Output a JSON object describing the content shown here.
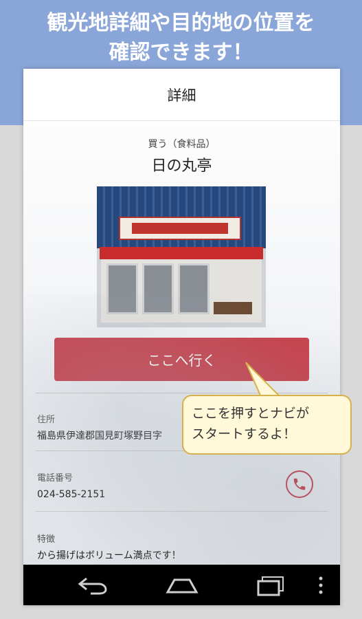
{
  "banner": {
    "line1": "観光地詳細や目的地の位置を",
    "line2": "確認できます！"
  },
  "appbar": {
    "title": "詳細"
  },
  "place": {
    "category": "買う（食料品）",
    "name": "日の丸亭"
  },
  "actions": {
    "go_label": "ここへ行く"
  },
  "fields": {
    "address_label": "住所",
    "address_value": "福島県伊達郡国見町塚野目字",
    "phone_label": "電話番号",
    "phone_value": "024-585-2151",
    "feature_label": "特徴",
    "feature_value": "から揚げはボリューム満点です！"
  },
  "tooltip": {
    "line1": "ここを押すとナビが",
    "line2": "スタートするよ！"
  },
  "icons": {
    "phone": "phone-icon",
    "back": "back-icon",
    "home": "home-icon",
    "recent": "recent-apps-icon",
    "menu": "overflow-menu-icon"
  },
  "colors": {
    "banner": "#8aa6d8",
    "accent": "#c6434e",
    "tooltip_bg": "#fff9d9",
    "tooltip_border": "#d6b04a"
  }
}
